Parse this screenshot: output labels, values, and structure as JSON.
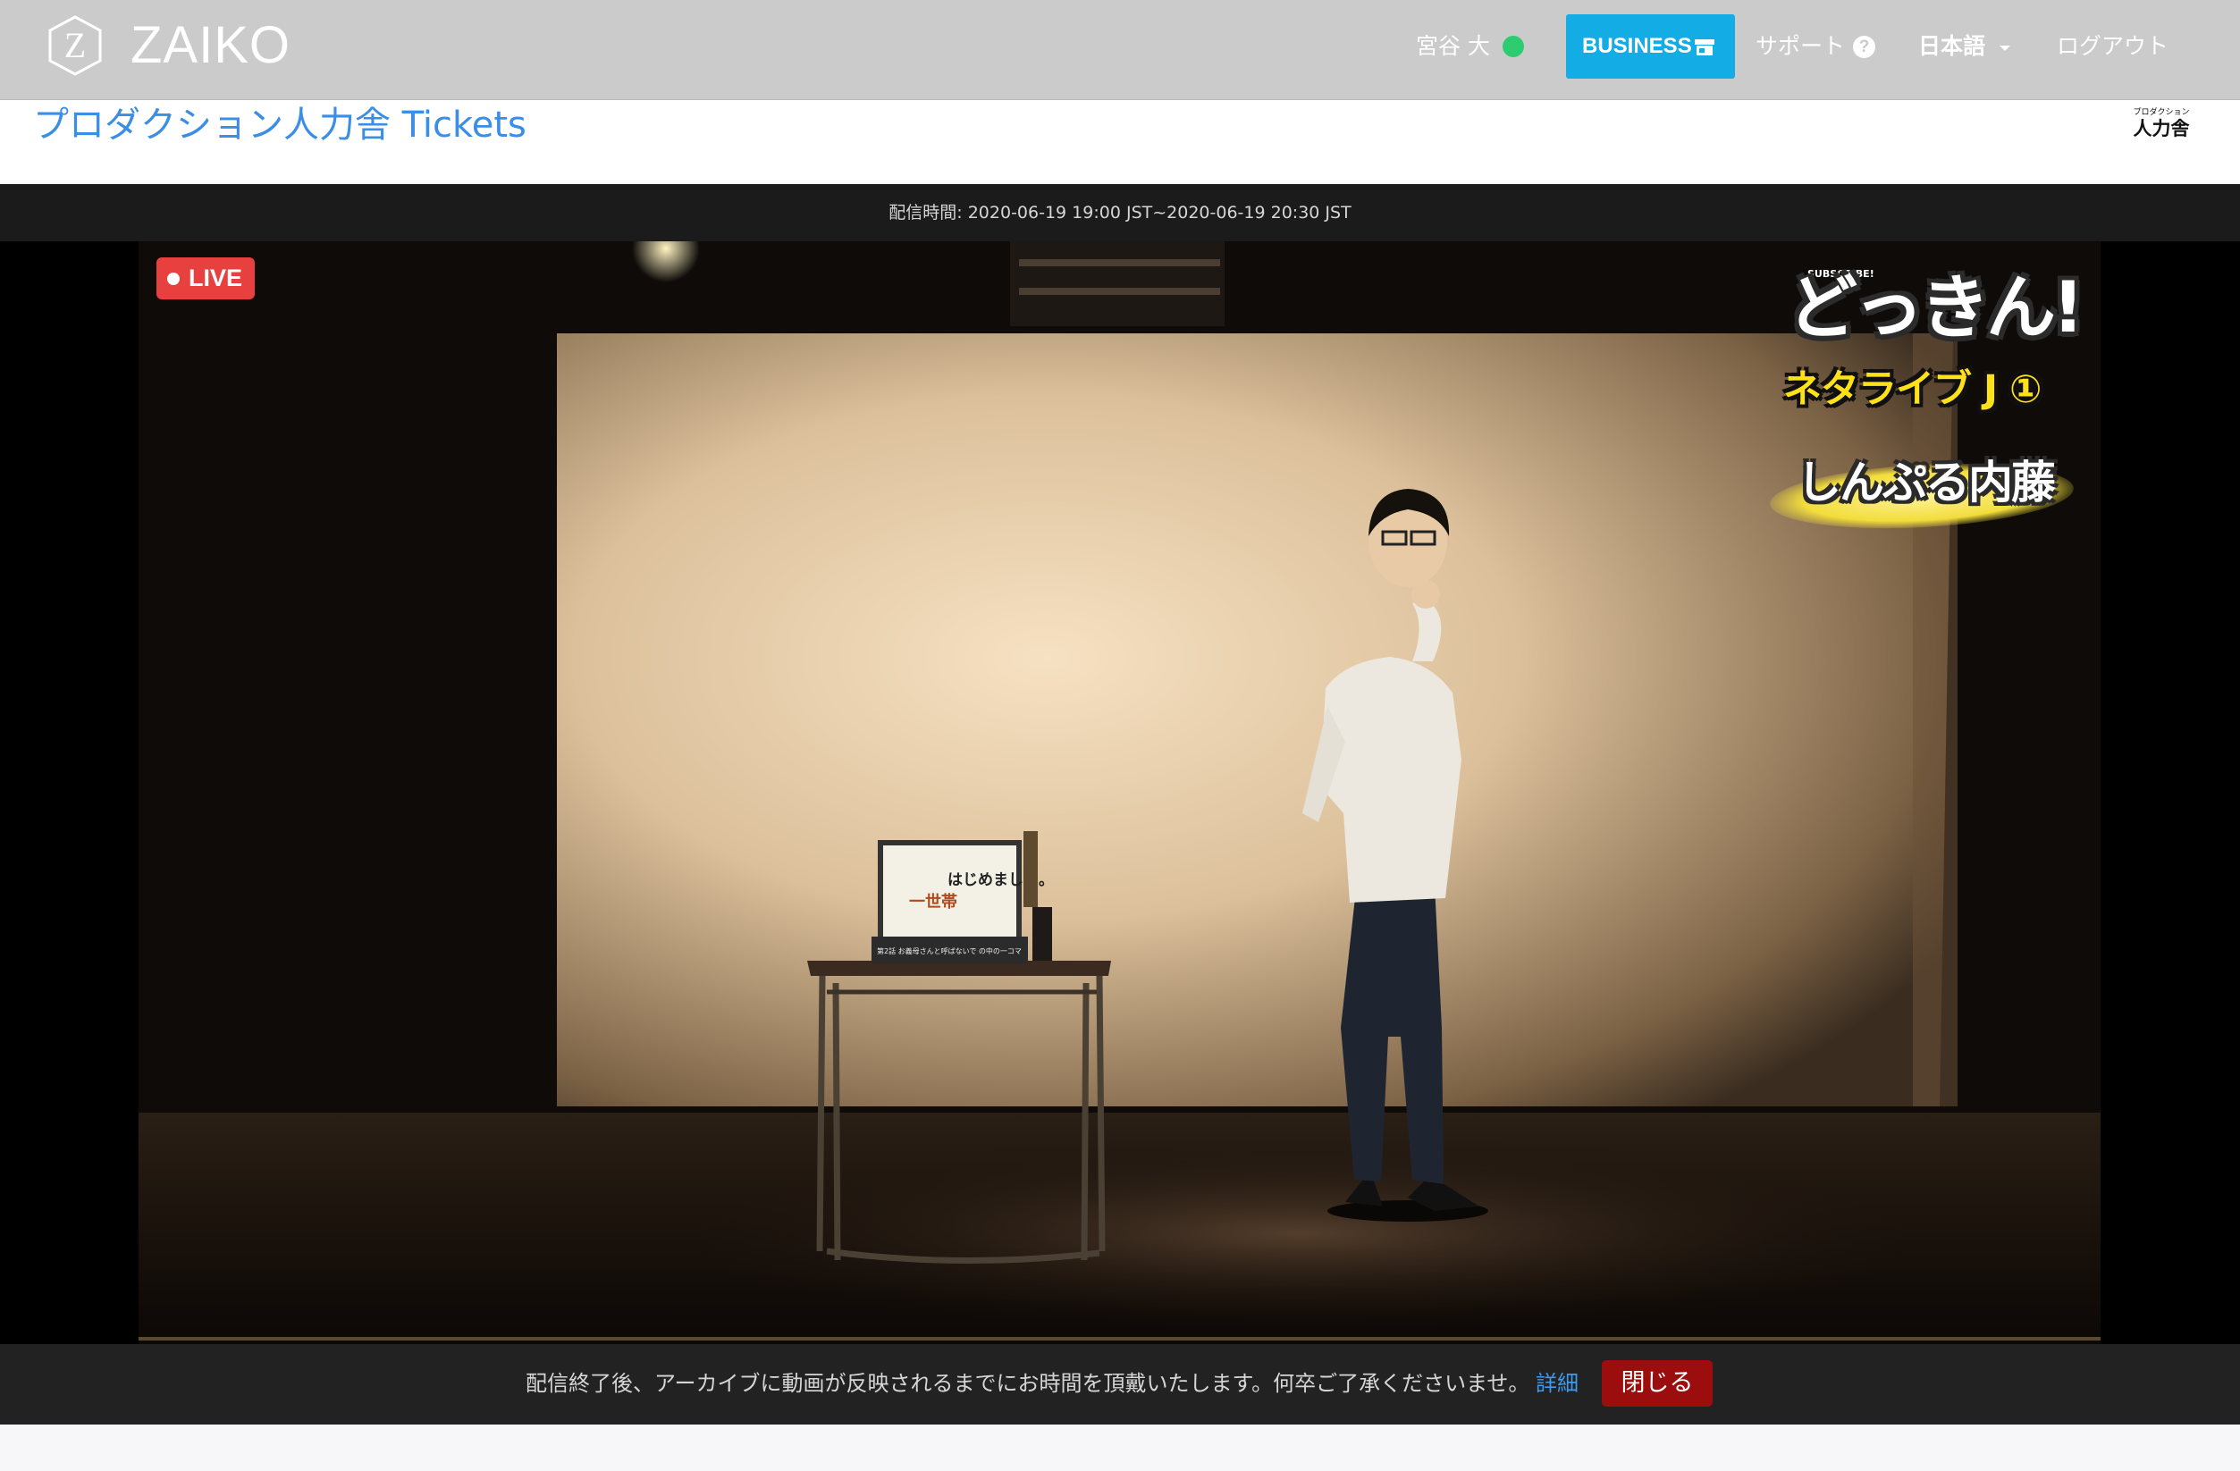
{
  "nav": {
    "brand": "ZAIKO",
    "brand_mark": "Z",
    "user_name": "宮谷 大",
    "business_label": "BUSINESS",
    "support_label": "サポート",
    "help_icon_glyph": "?",
    "language_label": "日本語",
    "logout_label": "ログアウト",
    "status_color": "#2ecc71",
    "accent_color": "#13ace4"
  },
  "header": {
    "title": "プロダクション人力舎 Tickets",
    "org_logo_small": "プロダクション",
    "org_logo_big": "人力舎"
  },
  "stream": {
    "schedule": "配信時間: 2020-06-19 19:00 JST~2020-06-19 20:30 JST",
    "live_label": "LIVE",
    "overlay": {
      "kicker": "SUBSCRIBE!",
      "title": "どっきん!",
      "subtitle": "ネタライブ J ①",
      "performer": "しんぷる内藤"
    },
    "stage_sign": {
      "line1": "一世帯",
      "line2": "はじめました。",
      "line3": "第2話 お義母さんと呼ばないで の中の一コマ"
    }
  },
  "notice": {
    "text": "配信終了後、アーカイブに動画が反映されるまでにお時間を頂戴いたします。何卒ご了承くださいませ。",
    "link_label": "詳細",
    "close_label": "閉じる"
  }
}
